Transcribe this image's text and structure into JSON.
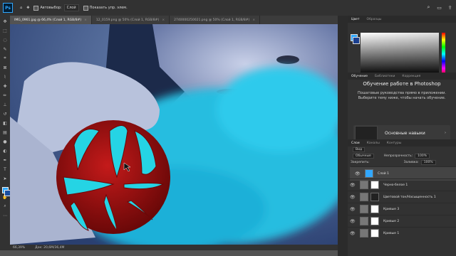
{
  "colors": {
    "accent": "#31a8ff",
    "fg": "#31a8ff",
    "bg": "#1a3f8f",
    "ball": "#b01515",
    "smoke": "#27c6e8"
  },
  "options": {
    "autoselect": "Автовыбор:",
    "autoselect_value": "Слой",
    "show_controls": "Показать упр. элем."
  },
  "tabs": [
    {
      "label": "IMG_0961.jpg @ 66,4% (Слой 1, RGB/8#)",
      "active": true
    },
    {
      "label": "12_0159.png @ 50% (Слой 1, RGB/8#)",
      "active": false
    },
    {
      "label": "2740000250021.png @ 50% (Слой 1, RGB/8#)",
      "active": false
    }
  ],
  "status": {
    "zoom": "66,39%",
    "doc": "Док: 20,6M/36,4M"
  },
  "color_panel": {
    "tabs": [
      "Цвет",
      "Образцы"
    ]
  },
  "learn_panel": {
    "tabs": [
      "Обучение",
      "Библиотеки",
      "Коррекция"
    ],
    "title": "Обучение работе в Photoshop",
    "desc": "Пошаговые руководства прямо в приложении. Выберите тему ниже, чтобы начать обучение.",
    "card_title": "Основные навыки"
  },
  "layers_panel": {
    "tabs": [
      "Слои",
      "Каналы",
      "Контуры"
    ],
    "kind": "Вид",
    "blend": "Обычные",
    "opacity_label": "Непрозрачность:",
    "opacity": "100%",
    "lock_label": "Закрепить:",
    "fill_label": "Заливка:",
    "fill": "100%",
    "layers": [
      {
        "name": "Слой 1",
        "selected": true
      },
      {
        "name": "Черно-белое 1",
        "selected": false
      },
      {
        "name": "Цветовой тон/Насыщенность 1",
        "selected": false
      },
      {
        "name": "Кривые 3",
        "selected": false
      },
      {
        "name": "Кривые 2",
        "selected": false
      },
      {
        "name": "Кривые 1",
        "selected": false
      }
    ]
  }
}
